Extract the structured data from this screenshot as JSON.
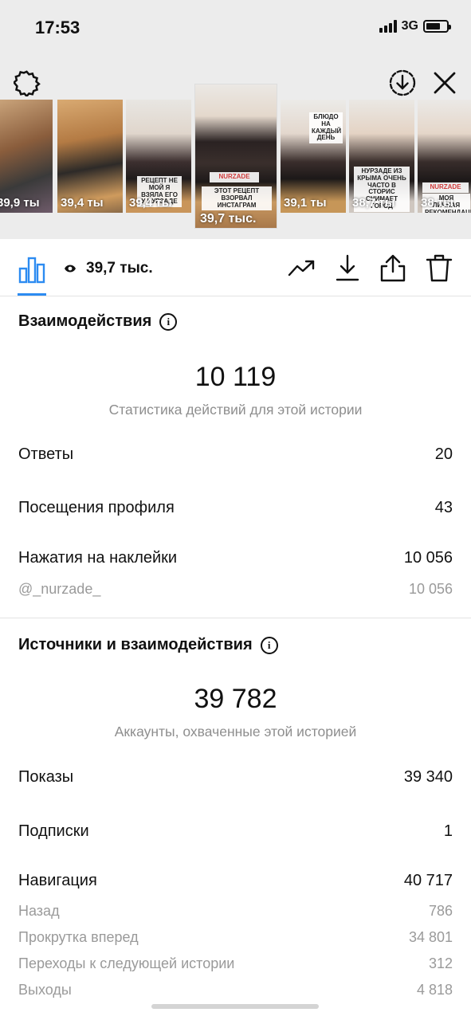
{
  "status_bar": {
    "time": "17:53",
    "network": "3G"
  },
  "stories": [
    {
      "views": "39,9 ты",
      "caption": ""
    },
    {
      "views": "39,4 ты",
      "caption": ""
    },
    {
      "views": "39,4 ты",
      "caption": "РЕЦЕПТ НЕ МОЙ Я ВЗЯЛА ЕГО У НУРЗАДЕ"
    },
    {
      "views": "39,7 тыс.",
      "caption": "ЭТОТ РЕЦЕПТ ВЗОРВАЛ ИНСТАГРАМ",
      "tag": "NURZADE"
    },
    {
      "views": "39,1 ты",
      "caption": "БЛЮДО НА КАЖДЫЙ ДЕНЬ"
    },
    {
      "views": "38,7 ты",
      "caption": "НУРЗАДЕ ИЗ КРЫМА ОЧЕНЬ ЧАСТО В СТОРИС СНИМАЕТ ГОРОД"
    },
    {
      "views": "38 ты",
      "caption": "МОЯ ЛИЧНАЯ РЕКОМЕНДАЦИЯ",
      "tag": "NURZADE"
    }
  ],
  "toolbar": {
    "views": "39,7 тыс."
  },
  "interactions": {
    "title": "Взаимодействия",
    "total": "10 119",
    "total_label": "Статистика действий для этой истории",
    "rows": [
      {
        "label": "Ответы",
        "value": "20"
      },
      {
        "label": "Посещения профиля",
        "value": "43"
      },
      {
        "label": "Нажатия на наклейки",
        "value": "10 056"
      }
    ],
    "sticker_sub": {
      "label": "@_nurzade_",
      "value": "10 056"
    }
  },
  "sources": {
    "title": "Источники и взаимодействия",
    "total": "39 782",
    "total_label": "Аккаунты, охваченные этой историей",
    "rows": [
      {
        "label": "Показы",
        "value": "39 340"
      },
      {
        "label": "Подписки",
        "value": "1"
      },
      {
        "label": "Навигация",
        "value": "40 717"
      }
    ],
    "nav_sub": [
      {
        "label": "Назад",
        "value": "786"
      },
      {
        "label": "Прокрутка вперед",
        "value": "34 801"
      },
      {
        "label": "Переходы к следующей истории",
        "value": "312"
      },
      {
        "label": "Выходы",
        "value": "4 818"
      }
    ]
  },
  "colors": {
    "accent": "#2c8bf1",
    "muted": "#8e8e8e"
  }
}
